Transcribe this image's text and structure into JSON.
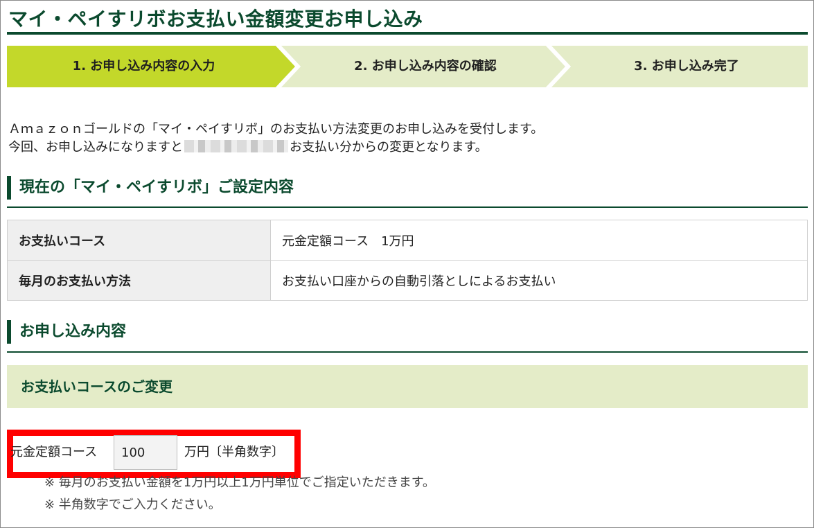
{
  "page": {
    "title": "マイ・ペイすリボお支払い金額変更お申し込み"
  },
  "steps": [
    {
      "label": "1. お申し込み内容の入力",
      "state": "active"
    },
    {
      "label": "2. お申し込み内容の確認",
      "state": "pending"
    },
    {
      "label": "3. お申し込み完了",
      "state": "pending"
    }
  ],
  "intro": {
    "line1": "Ａｍａｚｏｎゴールドの「マイ・ペイすリボ」のお支払い方法変更のお申し込みを受付します。",
    "line2_before": "今回、お申し込みになりますと",
    "line2_after": "お支払い分からの変更となります。"
  },
  "current_settings": {
    "heading": "現在の「マイ・ペイすリボ」ご設定内容",
    "rows": [
      {
        "label": "お支払いコース",
        "value": "元金定額コース　1万円"
      },
      {
        "label": "毎月のお支払い方法",
        "value": "お支払い口座からの自動引落としによるお支払い"
      }
    ]
  },
  "application": {
    "heading": "お申し込み内容",
    "subheading": "お支払いコースのご変更",
    "course_label": "元金定額コース",
    "amount_value": "100",
    "unit_label": "万円〔半角数字〕",
    "notes": [
      "※ 毎月のお支払い金額を1万円以上1万円単位でご指定いただきます。",
      "※ 半角数字でご入力ください。"
    ]
  },
  "colors": {
    "brand_green": "#0b4a2e",
    "step_active": "#c3d82a",
    "step_inactive": "#e4ecc8",
    "highlight_red": "#ff0000"
  }
}
